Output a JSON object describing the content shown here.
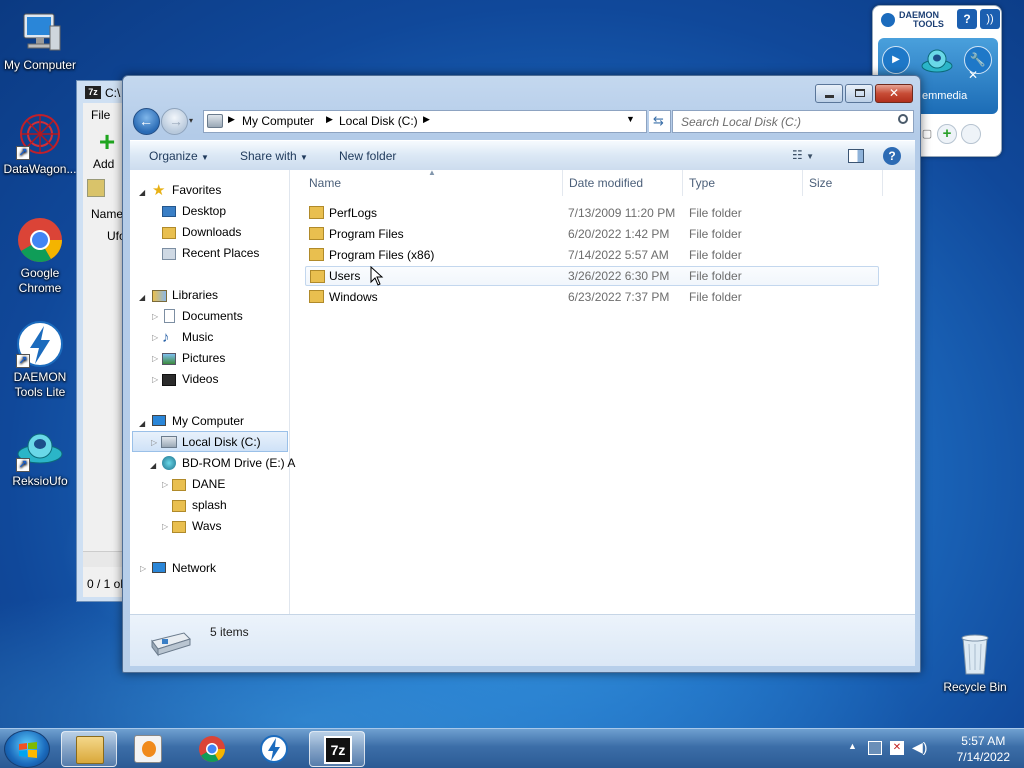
{
  "desktop": {
    "icons": [
      {
        "label": "My Computer"
      },
      {
        "label": "DataWagon..."
      },
      {
        "label": "Google Chrome"
      },
      {
        "label": "DAEMON Tools Lite"
      },
      {
        "label": "ReksioUfo"
      },
      {
        "label": "Recycle Bin"
      }
    ]
  },
  "background_window": {
    "title": "C:\\",
    "menu_file": "File",
    "add_label": "Add",
    "column_name": "Name",
    "row_text": "Ufo",
    "status": "0 / 1 ob"
  },
  "daemon_gadget": {
    "logo_line1": "DAEMON",
    "logo_line2": "TOOLS",
    "device_label": "emmedia"
  },
  "explorer": {
    "address": {
      "crumbs": [
        "My Computer",
        "Local Disk (C:)"
      ]
    },
    "search_placeholder": "Search Local Disk (C:)",
    "toolbar": {
      "organize": "Organize",
      "share_with": "Share with",
      "new_folder": "New folder"
    },
    "nav": {
      "favorites": "Favorites",
      "desktop": "Desktop",
      "downloads": "Downloads",
      "recent_places": "Recent Places",
      "libraries": "Libraries",
      "documents": "Documents",
      "music": "Music",
      "pictures": "Pictures",
      "videos": "Videos",
      "my_computer": "My Computer",
      "local_disk": "Local Disk (C:)",
      "bd_rom": "BD-ROM Drive (E:) A",
      "dane": "DANE",
      "splash": "splash",
      "wavs": "Wavs",
      "network": "Network"
    },
    "columns": {
      "name": "Name",
      "date_modified": "Date modified",
      "type": "Type",
      "size": "Size"
    },
    "files": [
      {
        "name": "PerfLogs",
        "date": "7/13/2009 11:20 PM",
        "type": "File folder"
      },
      {
        "name": "Program Files",
        "date": "6/20/2022 1:42 PM",
        "type": "File folder"
      },
      {
        "name": "Program Files (x86)",
        "date": "7/14/2022 5:57 AM",
        "type": "File folder"
      },
      {
        "name": "Users",
        "date": "3/26/2022 6:30 PM",
        "type": "File folder"
      },
      {
        "name": "Windows",
        "date": "6/23/2022 7:37 PM",
        "type": "File folder"
      }
    ],
    "details_count": "5 items"
  },
  "taskbar": {
    "clock_time": "5:57 AM",
    "clock_date": "7/14/2022",
    "sevenzip_label": "7z"
  },
  "colors": {
    "folder": "#e9bf4f",
    "accent": "#1e6fc4"
  }
}
